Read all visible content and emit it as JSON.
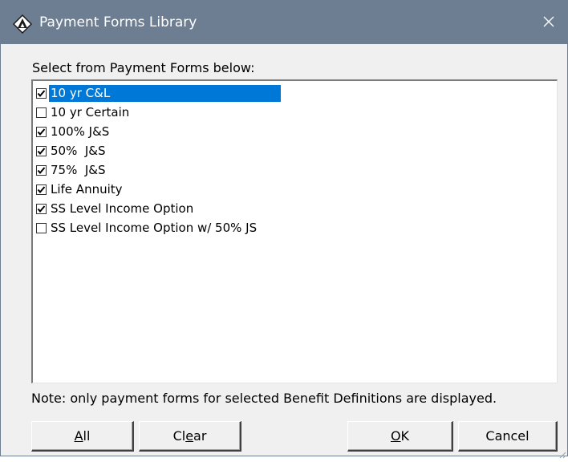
{
  "window": {
    "title": "Payment Forms Library",
    "icon": "app-logo-icon",
    "close_icon": "close-icon"
  },
  "prompt": "Select from Payment Forms below:",
  "payment_forms": [
    {
      "label": "10 yr C&L",
      "checked": true,
      "selected": true
    },
    {
      "label": "10 yr Certain",
      "checked": false,
      "selected": false
    },
    {
      "label": "100% J&S",
      "checked": true,
      "selected": false
    },
    {
      "label": "50%  J&S",
      "checked": true,
      "selected": false
    },
    {
      "label": "75%  J&S",
      "checked": true,
      "selected": false
    },
    {
      "label": "Life Annuity",
      "checked": true,
      "selected": false
    },
    {
      "label": "SS Level Income Option",
      "checked": true,
      "selected": false
    },
    {
      "label": "SS Level Income Option w/ 50% JS",
      "checked": false,
      "selected": false
    }
  ],
  "note": "Note: only payment forms for selected Benefit Definitions are displayed.",
  "buttons": {
    "all": {
      "pre": "",
      "mnemonic": "A",
      "post": "ll"
    },
    "clear": {
      "pre": "Cl",
      "mnemonic": "e",
      "post": "ar"
    },
    "ok": {
      "pre": "",
      "mnemonic": "O",
      "post": "K"
    },
    "cancel": {
      "label": "Cancel"
    }
  },
  "colors": {
    "titlebar": "#6d7e92",
    "selection": "#0078d7",
    "dialog_bg": "#f0f0f0"
  }
}
